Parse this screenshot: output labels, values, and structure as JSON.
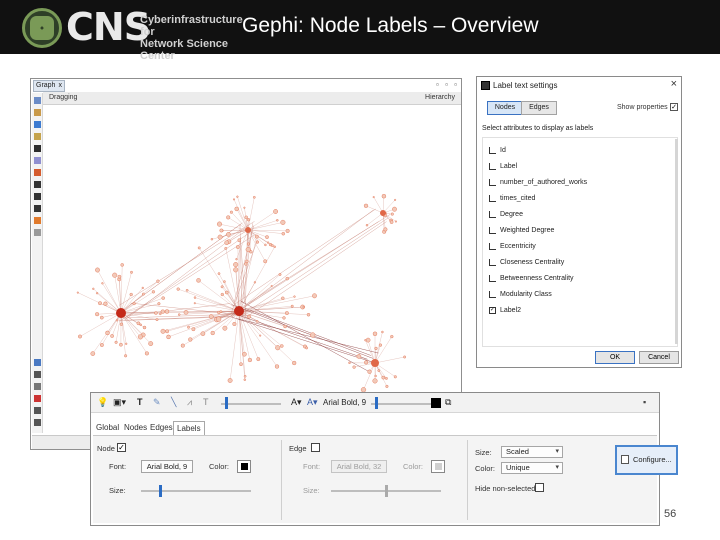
{
  "header": {
    "logo_text": "CNS",
    "logo_subtitle_1": "Cyberinfrastructure for",
    "logo_subtitle_2": "Network Science Center",
    "slide_title": "Gephi: Node Labels – Overview"
  },
  "gephi": {
    "tab_label": "Graph",
    "tab_close": "x",
    "toolbar_left": "Dragging",
    "toolbar_right": "Hierarchy"
  },
  "dialog": {
    "title": "Label text settings",
    "close": "×",
    "tab_nodes": "Nodes",
    "tab_edges": "Edges",
    "show_properties": "Show properties",
    "select_prompt": "Select attributes to display as labels",
    "attributes": [
      {
        "label": "Id",
        "checked": false
      },
      {
        "label": "Label",
        "checked": false
      },
      {
        "label": "number_of_authored_works",
        "checked": false
      },
      {
        "label": "times_cited",
        "checked": false
      },
      {
        "label": "Degree",
        "checked": false
      },
      {
        "label": "Weighted Degree",
        "checked": false
      },
      {
        "label": "Eccentricity",
        "checked": false
      },
      {
        "label": "Closeness Centrality",
        "checked": false
      },
      {
        "label": "Betweenness Centrality",
        "checked": false
      },
      {
        "label": "Modularity Class",
        "checked": false
      },
      {
        "label": "Label2",
        "checked": true
      }
    ],
    "ok": "OK",
    "cancel": "Cancel"
  },
  "panel": {
    "toolbar_font_1": "Arial Bold, 9",
    "toolbar_a1": "A",
    "toolbar_a2": "A",
    "tabs": [
      "Global",
      "Nodes",
      "Edges",
      "Labels"
    ],
    "active_tab": "Labels",
    "node_section": {
      "label": "Node",
      "checked": true,
      "font_label": "Font:",
      "font_value": "Arial Bold, 9",
      "color_label": "Color:",
      "size_label": "Size:",
      "color": "#000000"
    },
    "edge_section": {
      "label": "Edge",
      "checked": false,
      "font_label": "Font:",
      "font_value": "Arial Bold, 32",
      "color_label": "Color:",
      "size_label": "Size:"
    },
    "options": {
      "size_label": "Size:",
      "size_value": "Scaled",
      "color_label": "Color:",
      "color_value": "Unique",
      "hide_label": "Hide non-selected",
      "hide_checked": false
    },
    "configure_button": "Configure..."
  },
  "page_number": "56",
  "colors": {
    "banner": "#111111",
    "accent_blue": "#2b6cc4",
    "node_color": "#e06848",
    "edge_color": "#c9867a"
  }
}
